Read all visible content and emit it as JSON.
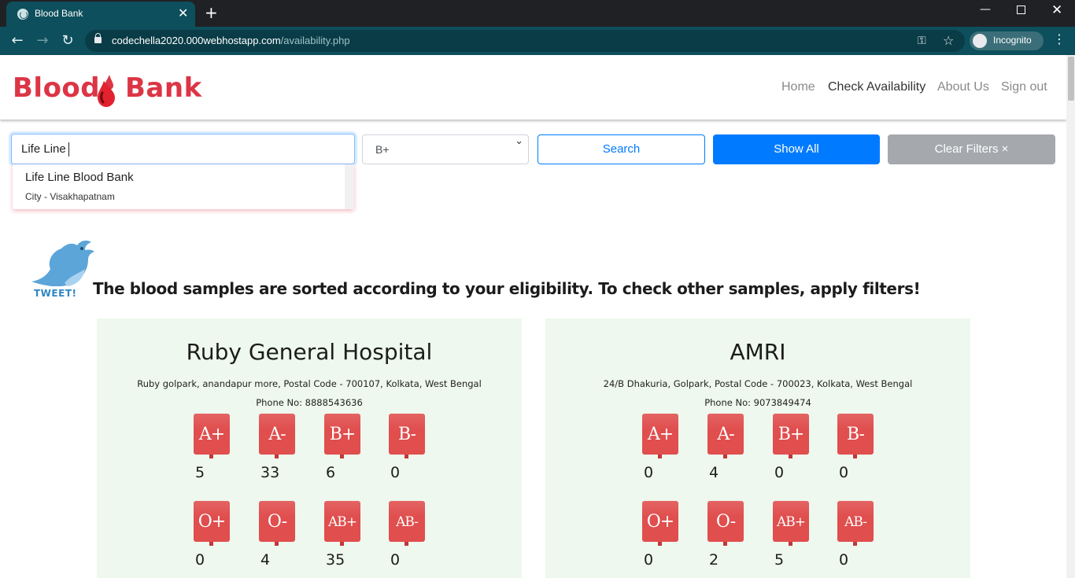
{
  "browser": {
    "tab_title": "Blood Bank",
    "url_host": "codechella2020.000webhostapp.com",
    "url_path": "/availability.php",
    "incognito_label": "Incognito"
  },
  "header": {
    "brand_left": "Blood",
    "brand_right": "Bank",
    "nav": [
      "Home",
      "Check Availability",
      "About Us",
      "Sign out"
    ],
    "active_nav": "Check Availability"
  },
  "filters": {
    "search_value": "Life Line",
    "suggestion": {
      "name": "Life Line Blood Bank",
      "city": "City - Visakhapatnam"
    },
    "blood_group": "B+",
    "search_button": "Search",
    "show_all_button": "Show All",
    "clear_button": "Clear Filters ×"
  },
  "notice": {
    "tweet_label": "TWEET!",
    "text": "The blood samples are sorted according to your eligibility. To check other samples, apply filters!"
  },
  "groups": [
    "A+",
    "A-",
    "B+",
    "B-",
    "O+",
    "O-",
    "AB+",
    "AB-"
  ],
  "hospitals": [
    {
      "name": "Ruby General Hospital",
      "address": "Ruby golpark, anandapur more, Postal Code - 700107, Kolkata, West Bengal",
      "phone": "Phone No: 8888543636",
      "counts": [
        "5",
        "33",
        "6",
        "0",
        "0",
        "4",
        "35",
        "0"
      ]
    },
    {
      "name": "AMRI",
      "address": "24/B Dhakuria, Golpark, Postal Code - 700023, Kolkata, West Bengal",
      "phone": "Phone No: 9073849474",
      "counts": [
        "0",
        "4",
        "0",
        "0",
        "0",
        "2",
        "5",
        "0"
      ]
    }
  ],
  "colors": {
    "brand": "#dc3545",
    "primary": "#007bff",
    "bag": "#e04e4e",
    "card_bg": "#eef8ee",
    "chrome": "#0d4f5c"
  }
}
